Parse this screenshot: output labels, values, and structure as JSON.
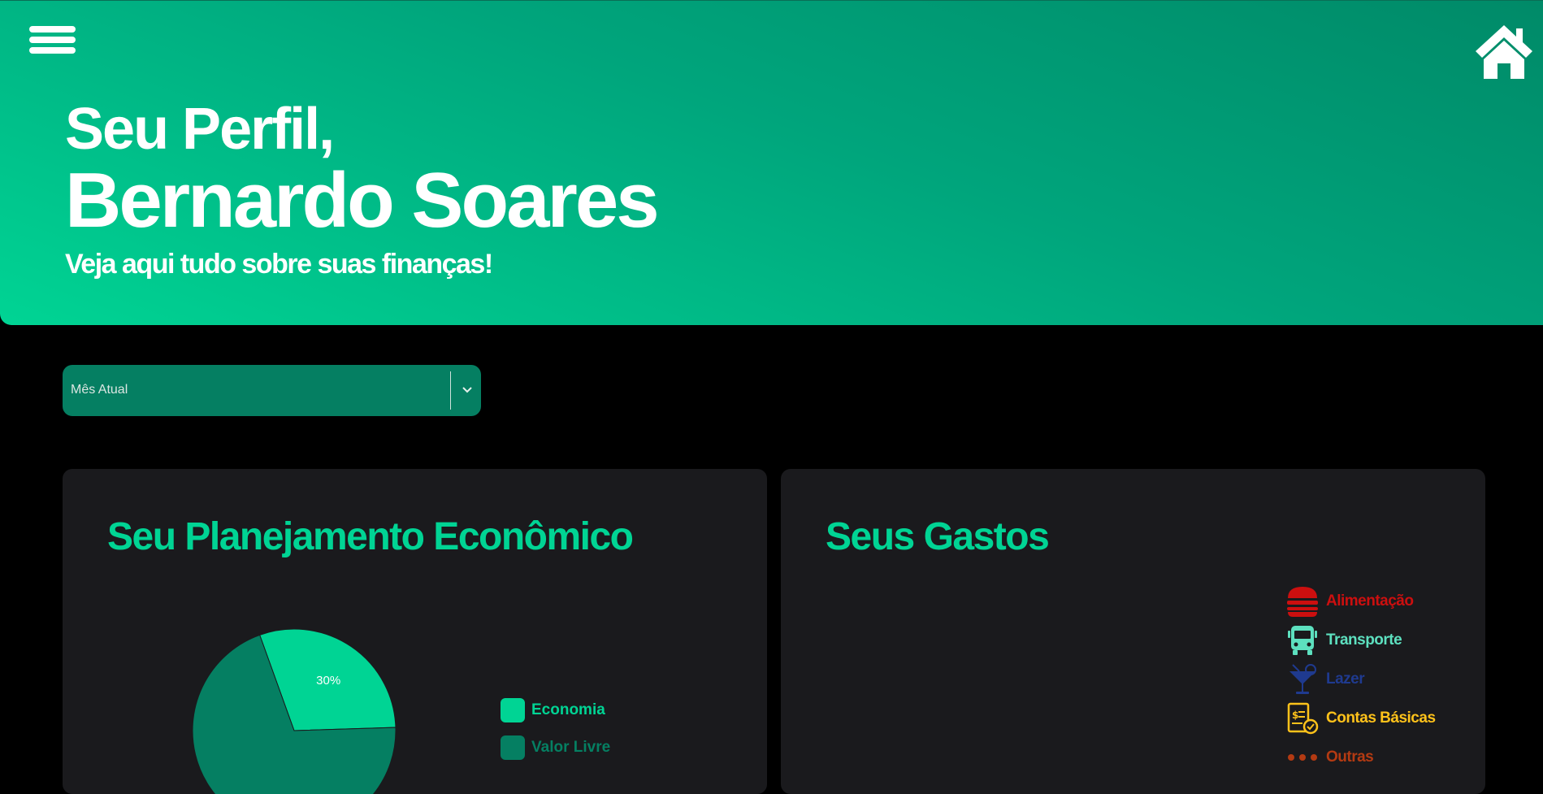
{
  "header": {
    "greeting": "Seu Perfil,",
    "user_name": "Bernardo Soares",
    "subtitle": "Veja aqui tudo sobre suas finanças!",
    "menu_icon": "hamburger-menu-icon",
    "home_icon": "home-icon"
  },
  "period_select": {
    "selected": "Mês Atual",
    "icon": "chevron-down-icon"
  },
  "planning_card": {
    "title": "Seu Planejamento Econômico",
    "legend": [
      {
        "label": "Economia",
        "color": "#00d494"
      },
      {
        "label": "Valor Livre",
        "color": "#057f62"
      }
    ]
  },
  "expenses_card": {
    "title": "Seus Gastos",
    "categories": [
      {
        "label": "Alimentação",
        "color": "#cc0f0f",
        "icon": "burger-icon"
      },
      {
        "label": "Transporte",
        "color": "#5de0bf",
        "icon": "bus-icon"
      },
      {
        "label": "Lazer",
        "color": "#1f3a8f",
        "icon": "cocktail-icon"
      },
      {
        "label": "Contas Básicas",
        "color": "#ffc21a",
        "icon": "bill-icon"
      },
      {
        "label": "Outras",
        "color": "#b33a12",
        "icon": "dots-icon"
      }
    ]
  },
  "chart_data": {
    "type": "pie",
    "title": "",
    "categories": [
      "Economia",
      "Valor Livre"
    ],
    "values": [
      30,
      70
    ],
    "colors": [
      "#00d494",
      "#057f62"
    ],
    "data_labels": [
      "30%",
      ""
    ],
    "legend": "right"
  }
}
